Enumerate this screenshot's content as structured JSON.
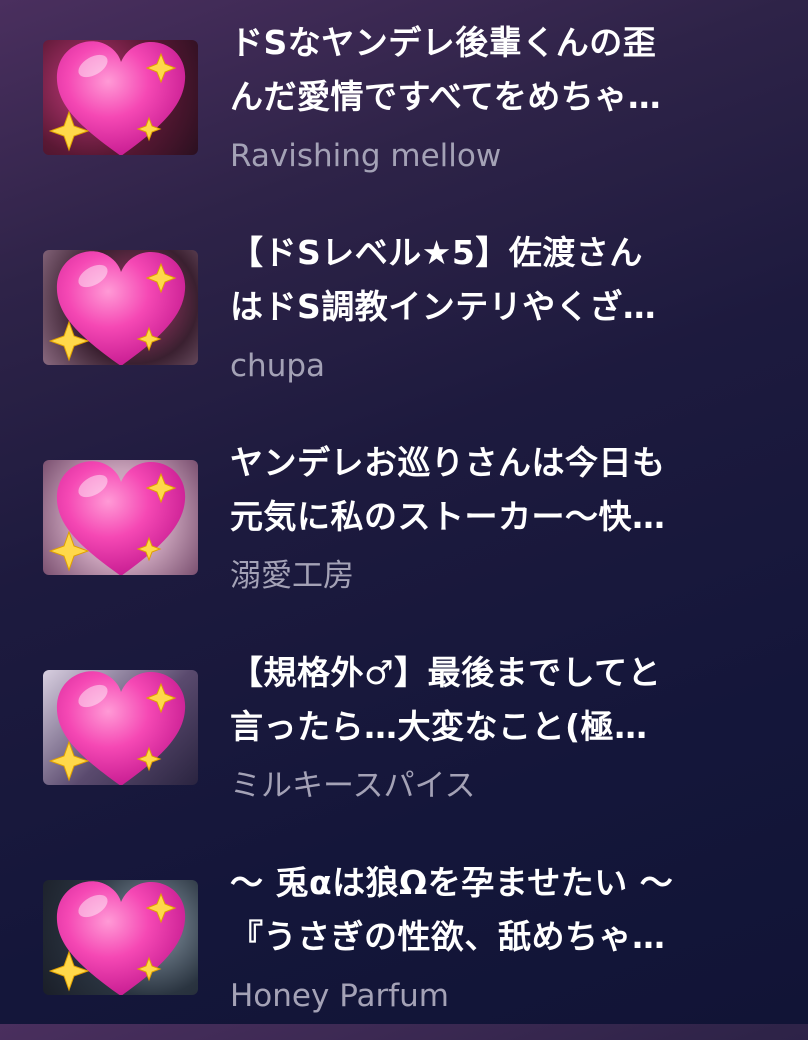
{
  "items": [
    {
      "title_line1": "ドSなヤンデレ後輩くんの歪",
      "title_line2": "んだ愛情ですべてをめちゃ…",
      "author": "Ravishing mellow",
      "thumb_icon": "sparkling-heart-icon",
      "thumb_colors": [
        "#5a1834",
        "#c23a7a",
        "#2a1020"
      ]
    },
    {
      "title_line1": "【ドSレベル★5】佐渡さん",
      "title_line2": "はドS調教インテリやくざ…",
      "author": "chupa",
      "thumb_icon": "sparkling-heart-icon",
      "thumb_colors": [
        "#3a2030",
        "#b03a6e",
        "#8a6a80"
      ]
    },
    {
      "title_line1": "ヤンデレお巡りさんは今日も",
      "title_line2": "元気に私のストーカー～快…",
      "author": "溺愛工房",
      "thumb_icon": "sparkling-heart-icon",
      "thumb_colors": [
        "#c7a0b8",
        "#e0c4d4",
        "#7a5070"
      ]
    },
    {
      "title_line1": "【規格外♂】最後までしてと",
      "title_line2": "言ったら…大変なこと(極…",
      "author": "ミルキースパイス",
      "thumb_icon": "sparkling-heart-icon",
      "thumb_colors": [
        "#d8cfe0",
        "#5a4a6e",
        "#2a2440"
      ]
    },
    {
      "title_line1": "～ 兎αは狼Ωを孕ませたい ～",
      "title_line2": "『うさぎの性欲、舐めちゃ…",
      "author": "Honey Parfum",
      "thumb_icon": "sparkling-heart-icon",
      "thumb_colors": [
        "#2a3440",
        "#8a9aa8",
        "#1a1e28"
      ]
    }
  ]
}
